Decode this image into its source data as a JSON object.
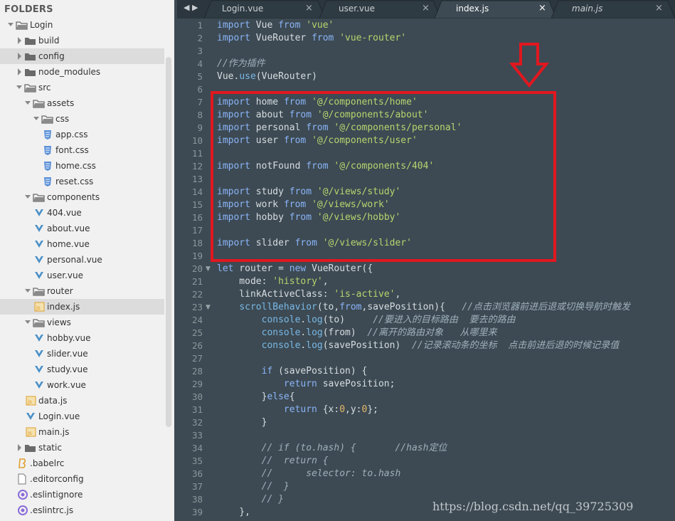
{
  "sidebar": {
    "title": "FOLDERS",
    "items": [
      {
        "label": "Login",
        "depth": 0,
        "type": "folder",
        "open": true
      },
      {
        "label": "build",
        "depth": 1,
        "type": "folder",
        "open": false
      },
      {
        "label": "config",
        "depth": 1,
        "type": "folder",
        "open": false,
        "selected": true
      },
      {
        "label": "node_modules",
        "depth": 1,
        "type": "folder",
        "open": false
      },
      {
        "label": "src",
        "depth": 1,
        "type": "folder",
        "open": true
      },
      {
        "label": "assets",
        "depth": 2,
        "type": "folder",
        "open": true
      },
      {
        "label": "css",
        "depth": 3,
        "type": "folder",
        "open": true
      },
      {
        "label": "app.css",
        "depth": 4,
        "type": "css"
      },
      {
        "label": "font.css",
        "depth": 4,
        "type": "css"
      },
      {
        "label": "home.css",
        "depth": 4,
        "type": "css"
      },
      {
        "label": "reset.css",
        "depth": 4,
        "type": "css"
      },
      {
        "label": "components",
        "depth": 2,
        "type": "folder",
        "open": true
      },
      {
        "label": "404.vue",
        "depth": 3,
        "type": "vue"
      },
      {
        "label": "about.vue",
        "depth": 3,
        "type": "vue"
      },
      {
        "label": "home.vue",
        "depth": 3,
        "type": "vue"
      },
      {
        "label": "personal.vue",
        "depth": 3,
        "type": "vue"
      },
      {
        "label": "user.vue",
        "depth": 3,
        "type": "vue"
      },
      {
        "label": "router",
        "depth": 2,
        "type": "folder",
        "open": true
      },
      {
        "label": "index.js",
        "depth": 3,
        "type": "js",
        "selected": true
      },
      {
        "label": "views",
        "depth": 2,
        "type": "folder",
        "open": true
      },
      {
        "label": "hobby.vue",
        "depth": 3,
        "type": "vue"
      },
      {
        "label": "slider.vue",
        "depth": 3,
        "type": "vue"
      },
      {
        "label": "study.vue",
        "depth": 3,
        "type": "vue"
      },
      {
        "label": "work.vue",
        "depth": 3,
        "type": "vue"
      },
      {
        "label": "data.js",
        "depth": 2,
        "type": "js"
      },
      {
        "label": "Login.vue",
        "depth": 2,
        "type": "vue"
      },
      {
        "label": "main.js",
        "depth": 2,
        "type": "js"
      },
      {
        "label": "static",
        "depth": 1,
        "type": "folder",
        "open": false
      },
      {
        "label": ".babelrc",
        "depth": 1,
        "type": "babel"
      },
      {
        "label": ".editorconfig",
        "depth": 1,
        "type": "file"
      },
      {
        "label": ".eslintignore",
        "depth": 1,
        "type": "eslint"
      },
      {
        "label": ".eslintrc.js",
        "depth": 1,
        "type": "eslint"
      }
    ]
  },
  "tabs": [
    {
      "label": "Login.vue",
      "active": false
    },
    {
      "label": "user.vue",
      "active": false
    },
    {
      "label": "index.js",
      "active": true
    },
    {
      "label": "main.js",
      "active": false
    }
  ],
  "nav": {
    "back": "◀",
    "forward": "▶"
  },
  "editor": {
    "lines": [
      {
        "n": "1",
        "t": [
          [
            "kw",
            "import"
          ],
          [
            "p",
            " Vue "
          ],
          [
            "kw",
            "from"
          ],
          [
            "p",
            " "
          ],
          [
            "str",
            "'vue'"
          ]
        ]
      },
      {
        "n": "2",
        "t": [
          [
            "kw",
            "import"
          ],
          [
            "p",
            " VueRouter "
          ],
          [
            "kw",
            "from"
          ],
          [
            "p",
            " "
          ],
          [
            "str",
            "'vue-router'"
          ]
        ]
      },
      {
        "n": "3",
        "t": []
      },
      {
        "n": "4",
        "t": [
          [
            "cm",
            "//作为插件"
          ]
        ]
      },
      {
        "n": "5",
        "t": [
          [
            "p",
            "Vue."
          ],
          [
            "fn",
            "use"
          ],
          [
            "p",
            "(VueRouter)"
          ]
        ]
      },
      {
        "n": "6",
        "t": []
      },
      {
        "n": "7",
        "t": [
          [
            "kw",
            "import"
          ],
          [
            "p",
            " home "
          ],
          [
            "kw",
            "from"
          ],
          [
            "p",
            " "
          ],
          [
            "str",
            "'@/components/home'"
          ]
        ]
      },
      {
        "n": "8",
        "t": [
          [
            "kw",
            "import"
          ],
          [
            "p",
            " about "
          ],
          [
            "kw",
            "from"
          ],
          [
            "p",
            " "
          ],
          [
            "str",
            "'@/components/about'"
          ]
        ]
      },
      {
        "n": "9",
        "t": [
          [
            "kw",
            "import"
          ],
          [
            "p",
            " personal "
          ],
          [
            "kw",
            "from"
          ],
          [
            "p",
            " "
          ],
          [
            "str",
            "'@/components/personal'"
          ]
        ]
      },
      {
        "n": "10",
        "t": [
          [
            "kw",
            "import"
          ],
          [
            "p",
            " user "
          ],
          [
            "kw",
            "from"
          ],
          [
            "p",
            " "
          ],
          [
            "str",
            "'@/components/user'"
          ]
        ]
      },
      {
        "n": "11",
        "t": []
      },
      {
        "n": "12",
        "t": [
          [
            "kw",
            "import"
          ],
          [
            "p",
            " notFound "
          ],
          [
            "kw",
            "from"
          ],
          [
            "p",
            " "
          ],
          [
            "str",
            "'@/components/404'"
          ]
        ]
      },
      {
        "n": "13",
        "t": []
      },
      {
        "n": "14",
        "t": [
          [
            "kw",
            "import"
          ],
          [
            "p",
            " study "
          ],
          [
            "kw",
            "from"
          ],
          [
            "p",
            " "
          ],
          [
            "str",
            "'@/views/study'"
          ]
        ]
      },
      {
        "n": "15",
        "t": [
          [
            "kw",
            "import"
          ],
          [
            "p",
            " work "
          ],
          [
            "kw",
            "from"
          ],
          [
            "p",
            " "
          ],
          [
            "str",
            "'@/views/work'"
          ]
        ]
      },
      {
        "n": "16",
        "t": [
          [
            "kw",
            "import"
          ],
          [
            "p",
            " hobby "
          ],
          [
            "kw",
            "from"
          ],
          [
            "p",
            " "
          ],
          [
            "str",
            "'@/views/hobby'"
          ]
        ]
      },
      {
        "n": "17",
        "t": []
      },
      {
        "n": "18",
        "t": [
          [
            "kw",
            "import"
          ],
          [
            "p",
            " slider "
          ],
          [
            "kw",
            "from"
          ],
          [
            "p",
            " "
          ],
          [
            "str",
            "'@/views/slider'"
          ]
        ]
      },
      {
        "n": "19",
        "t": []
      },
      {
        "n": "20",
        "fold": true,
        "t": [
          [
            "kw",
            "let"
          ],
          [
            "p",
            " router = "
          ],
          [
            "kw",
            "new"
          ],
          [
            "p",
            " VueRouter({"
          ]
        ]
      },
      {
        "n": "21",
        "t": [
          [
            "p",
            "    mode: "
          ],
          [
            "str",
            "'history'"
          ],
          [
            "p",
            ","
          ]
        ]
      },
      {
        "n": "22",
        "t": [
          [
            "p",
            "    linkActiveClass: "
          ],
          [
            "str",
            "'is-active'"
          ],
          [
            "p",
            ","
          ]
        ]
      },
      {
        "n": "23",
        "fold": true,
        "t": [
          [
            "p",
            "    "
          ],
          [
            "fn",
            "scrollBehavior"
          ],
          [
            "p",
            "(to,"
          ],
          [
            "kw",
            "from"
          ],
          [
            "p",
            ",savePosition){   "
          ],
          [
            "cm",
            "//点击浏览器前进后退或切换导航时触发"
          ]
        ]
      },
      {
        "n": "24",
        "t": [
          [
            "p",
            "        "
          ],
          [
            "fn",
            "console"
          ],
          [
            "p",
            "."
          ],
          [
            "fn",
            "log"
          ],
          [
            "p",
            "(to)     "
          ],
          [
            "cm",
            "//要进入的目标路由  要去的路由"
          ]
        ]
      },
      {
        "n": "25",
        "t": [
          [
            "p",
            "        "
          ],
          [
            "fn",
            "console"
          ],
          [
            "p",
            "."
          ],
          [
            "fn",
            "log"
          ],
          [
            "p",
            "(from)  "
          ],
          [
            "cm",
            "//离开的路由对象   从哪里来"
          ]
        ]
      },
      {
        "n": "26",
        "t": [
          [
            "p",
            "        "
          ],
          [
            "fn",
            "console"
          ],
          [
            "p",
            "."
          ],
          [
            "fn",
            "log"
          ],
          [
            "p",
            "(savePosition)  "
          ],
          [
            "cm",
            "//记录滚动条的坐标  点击前进后退的时候记录值"
          ]
        ]
      },
      {
        "n": "27",
        "t": []
      },
      {
        "n": "28",
        "t": [
          [
            "p",
            "        "
          ],
          [
            "kw",
            "if"
          ],
          [
            "p",
            " (savePosition) {"
          ]
        ]
      },
      {
        "n": "29",
        "t": [
          [
            "p",
            "            "
          ],
          [
            "kw",
            "return"
          ],
          [
            "p",
            " savePosition;"
          ]
        ]
      },
      {
        "n": "30",
        "t": [
          [
            "p",
            "        }"
          ],
          [
            "kw",
            "else"
          ],
          [
            "p",
            "{"
          ]
        ]
      },
      {
        "n": "31",
        "t": [
          [
            "p",
            "            "
          ],
          [
            "kw",
            "return"
          ],
          [
            "p",
            " {x:"
          ],
          [
            "num",
            "0"
          ],
          [
            "p",
            ",y:"
          ],
          [
            "num",
            "0"
          ],
          [
            "p",
            "};"
          ]
        ]
      },
      {
        "n": "32",
        "t": [
          [
            "p",
            "        }"
          ]
        ]
      },
      {
        "n": "33",
        "t": []
      },
      {
        "n": "34",
        "t": [
          [
            "p",
            "        "
          ],
          [
            "cm",
            "// if (to.hash) {       //hash定位"
          ]
        ]
      },
      {
        "n": "35",
        "t": [
          [
            "p",
            "        "
          ],
          [
            "cm",
            "//  return {"
          ]
        ]
      },
      {
        "n": "36",
        "t": [
          [
            "p",
            "        "
          ],
          [
            "cm",
            "//      selector: to.hash"
          ]
        ]
      },
      {
        "n": "37",
        "t": [
          [
            "p",
            "        "
          ],
          [
            "cm",
            "//  }"
          ]
        ]
      },
      {
        "n": "38",
        "t": [
          [
            "p",
            "        "
          ],
          [
            "cm",
            "// }"
          ]
        ]
      },
      {
        "n": "39",
        "t": [
          [
            "p",
            "    },"
          ]
        ]
      }
    ]
  },
  "watermark": "https://blog.csdn.net/qq_39725309",
  "colors": {
    "highlight_box": "#e1171f",
    "editor_bg": "#3d4a53",
    "tabbar_bg": "#2b363e"
  }
}
